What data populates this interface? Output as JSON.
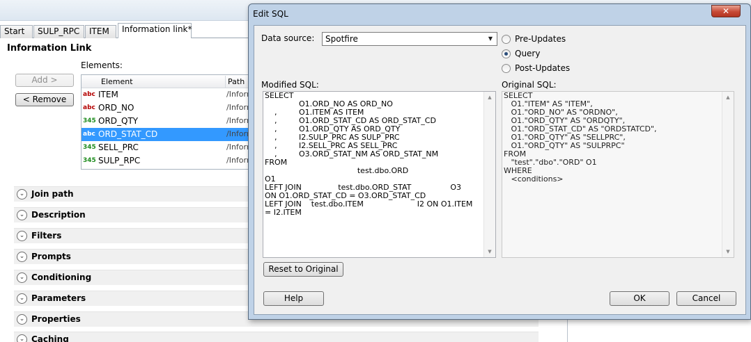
{
  "background_app": {
    "tabs": [
      "Start",
      "SULP_RPC",
      "ITEM",
      "Information link*"
    ],
    "title": "Information Link",
    "add_button": "Add >",
    "remove_button": "< Remove",
    "elements_label": "Elements:",
    "list_headers": {
      "element": "Element",
      "path": "Path"
    },
    "elements": [
      {
        "type": "abc",
        "name": "ITEM",
        "path": "/Inform"
      },
      {
        "type": "345",
        "name": "ORD_NO",
        "path": "/Inform"
      },
      {
        "type": "345",
        "name": "ORD_QTY",
        "path": "/Inform"
      },
      {
        "type": "abc",
        "name": "ORD_STAT_CD",
        "path": "/Inform"
      },
      {
        "type": "345",
        "name": "SELL_PRC",
        "path": "/Inform"
      },
      {
        "type": "345",
        "name": "SULP_RPC",
        "path": "/Inform"
      }
    ],
    "sections": [
      "Join path",
      "Description",
      "Filters",
      "Prompts",
      "Conditioning",
      "Parameters",
      "Properties",
      "Caching"
    ]
  },
  "dialog": {
    "title": "Edit SQL",
    "close_label": "✕",
    "data_source_label": "Data source:",
    "data_source_value": "Spotfire",
    "radios": [
      {
        "label": "Pre-Updates",
        "checked": false
      },
      {
        "label": "Query",
        "checked": true
      },
      {
        "label": "Post-Updates",
        "checked": false
      }
    ],
    "modified_sql_label": "Modified SQL:",
    "original_sql_label": "Original SQL:",
    "modified_sql": "SELECT\n              O1.ORD_NO AS ORD_NO\n    ,         O1.ITEM AS ITEM\n    ,         O1.ORD_STAT_CD AS ORD_STAT_CD\n    ,         O1.ORD_QTY AS ORD_QTY\n    ,         I2.SULP_PRC AS SULP_PRC\n    ,         I2.SELL_PRC AS SELL_PRC\n    ,         O3.ORD_STAT_NM AS ORD_STAT_NM\nFROM\n                                      test.dbo.ORD\nO1\nLEFT JOIN               test.dbo.ORD_STAT                O3\nON O1.ORD_STAT_CD = O3.ORD_STAT_CD\nLEFT JOIN    test.dbo.ITEM                      I2 ON O1.ITEM\n= I2.ITEM",
    "original_sql": "SELECT\n   O1.\"ITEM\" AS \"ITEM\",\n   O1.\"ORD_NO\" AS \"ORDNO\",\n   O1.\"ORD_QTY\" AS \"ORDQTY\",\n   O1.\"ORD_STAT_CD\" AS \"ORDSTATCD\",\n   O1.\"ORD_QTY\" AS \"SELLPRC\",\n   O1.\"ORD_QTY\" AS \"SULPRPC\"\nFROM\n   \"test\".\"dbo\".\"ORD\" O1\nWHERE\n   <conditions>",
    "reset_button": "Reset to Original",
    "help_button": "Help",
    "ok_button": "OK",
    "cancel_button": "Cancel"
  }
}
